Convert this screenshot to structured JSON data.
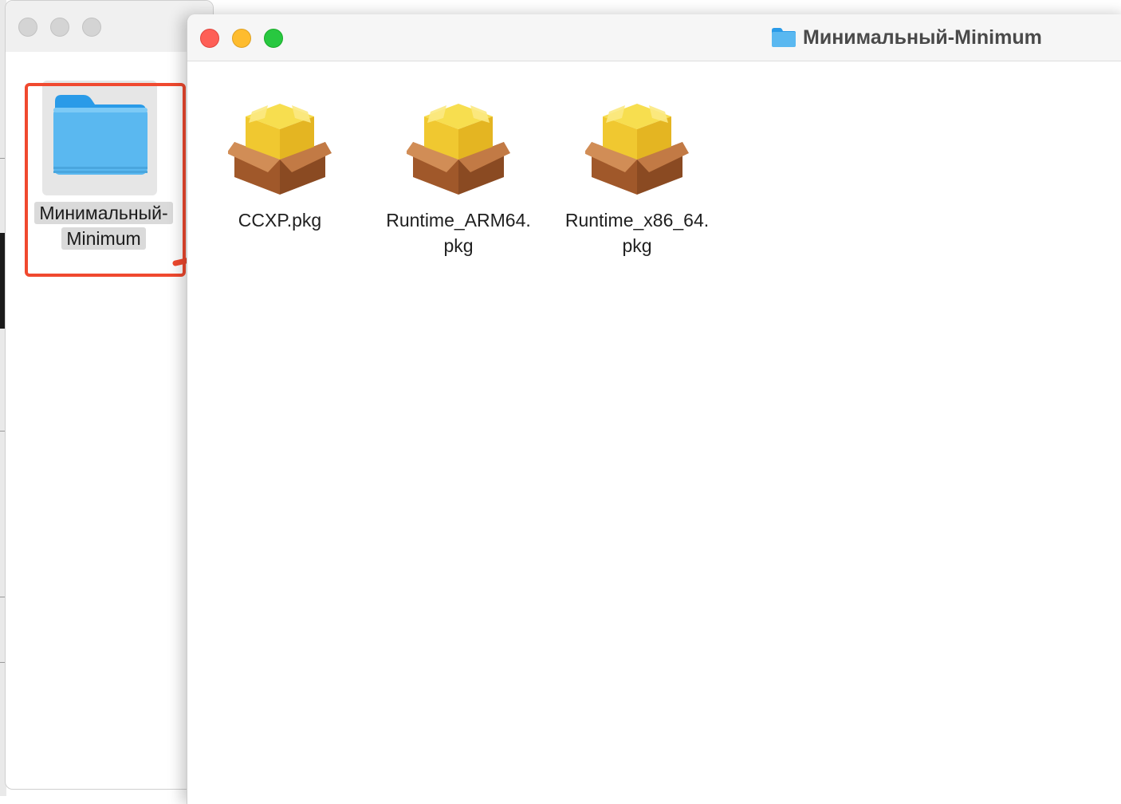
{
  "background_window": {
    "folder": {
      "name_line1": "Минимальный-",
      "name_line2": "Minimum"
    }
  },
  "front_window": {
    "title": "Минимальный-Minimum",
    "files": [
      {
        "name_line1": "CCXP.pkg",
        "name_line2": ""
      },
      {
        "name_line1": "Runtime_ARM64.",
        "name_line2": "pkg"
      },
      {
        "name_line1": "Runtime_x86_64.",
        "name_line2": "pkg"
      }
    ]
  },
  "annotation": {
    "color": "#f0492f"
  },
  "colors": {
    "close": "#fe5f57",
    "minimize": "#febc2e",
    "maximize": "#28c840",
    "folder": "#5ab8f0"
  },
  "icons": {
    "folder": "folder-icon",
    "package": "package-icon"
  }
}
